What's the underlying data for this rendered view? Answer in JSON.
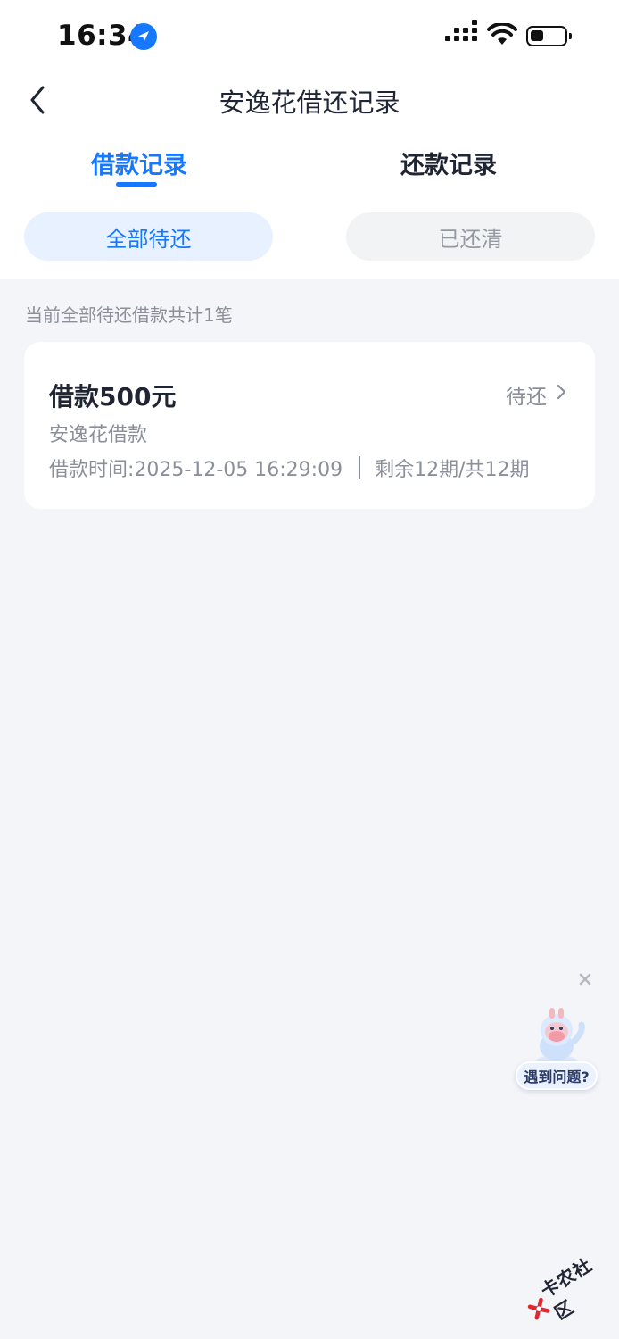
{
  "status_bar": {
    "time": "16:34",
    "icons": [
      "location-arrow-icon",
      "cellular-signal-icon",
      "wifi-icon",
      "battery-icon"
    ]
  },
  "nav": {
    "title": "安逸花借还记录",
    "back_icon": "chevron-left-icon"
  },
  "tabs": [
    {
      "label": "借款记录",
      "active": true
    },
    {
      "label": "还款记录",
      "active": false
    }
  ],
  "filters": [
    {
      "label": "全部待还",
      "active": true
    },
    {
      "label": "已还清",
      "active": false
    }
  ],
  "summary": "当前全部待还借款共计1笔",
  "loans": [
    {
      "amount": "借款500元",
      "status": "待还",
      "product": "安逸花借款",
      "time": "借款时间:2025-12-05 16:29:09",
      "periods": "剩余12期/共12期"
    }
  ],
  "help": {
    "label": "遇到问题?",
    "close_icon": "close-icon",
    "mascot_icon": "mascot-icon"
  },
  "watermark": {
    "text": "卡农社区"
  },
  "colors": {
    "accent": "#1677ff",
    "background": "#f4f5f8",
    "text_primary": "#1f2533",
    "text_secondary": "#8a8f99"
  }
}
